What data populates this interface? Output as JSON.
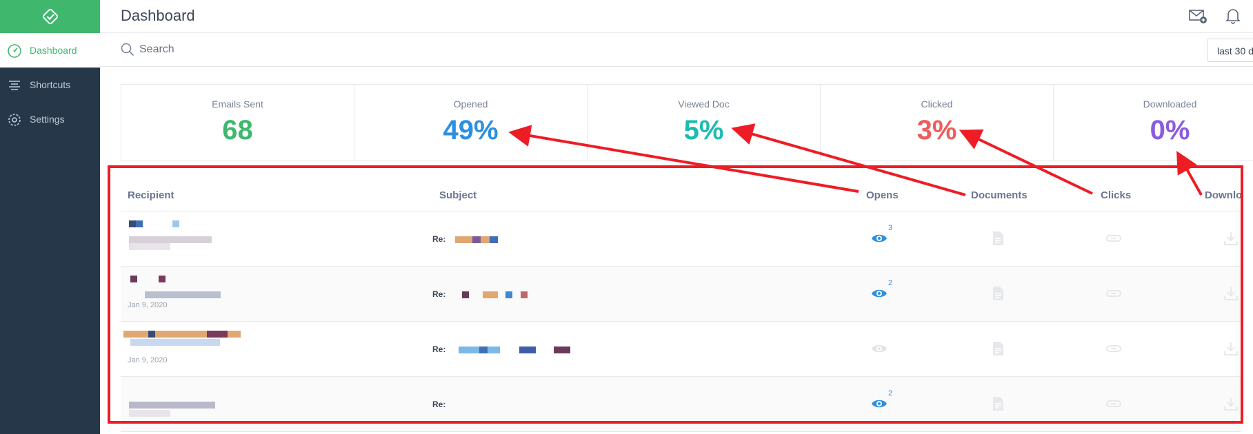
{
  "app": {
    "page_title": "Dashboard"
  },
  "sidebar": {
    "items": [
      {
        "label": "Dashboard",
        "icon": "speedometer-icon",
        "active": true
      },
      {
        "label": "Shortcuts",
        "icon": "lines-icon",
        "active": false
      },
      {
        "label": "Settings",
        "icon": "gear-icon",
        "active": false
      }
    ]
  },
  "topbar": {
    "icons": [
      "mail-add-icon",
      "bell-icon"
    ]
  },
  "search": {
    "placeholder": "Search",
    "value": ""
  },
  "range": {
    "label": "last 30 d"
  },
  "stats": [
    {
      "label": "Emails Sent",
      "value": "68",
      "color": "#3fb86e"
    },
    {
      "label": "Opened",
      "value": "49%",
      "color": "#2d8fe0"
    },
    {
      "label": "Viewed Doc",
      "value": "5%",
      "color": "#1bbcb0"
    },
    {
      "label": "Clicked",
      "value": "3%",
      "color": "#ef5c5c"
    },
    {
      "label": "Downloaded",
      "value": "0%",
      "color": "#8a5ce0"
    }
  ],
  "table": {
    "columns": [
      "Recipient",
      "Subject",
      "Opens",
      "Documents",
      "Clicks",
      "Downloads"
    ],
    "rows": [
      {
        "date": "",
        "subject_prefix": "Re:",
        "opens": "3",
        "opened": true
      },
      {
        "date": "Jan 9, 2020",
        "subject_prefix": "Re:",
        "opens": "2",
        "opened": true
      },
      {
        "date": "Jan 9, 2020",
        "subject_prefix": "Re:",
        "opens": "",
        "opened": false
      },
      {
        "date": "",
        "subject_prefix": "Re:",
        "opens": "2",
        "opened": true
      }
    ]
  },
  "colors": {
    "sidebar": "#26374a",
    "brand": "#3fb86e",
    "annotation": "#ee1c25",
    "link": "#2d8fe0"
  }
}
